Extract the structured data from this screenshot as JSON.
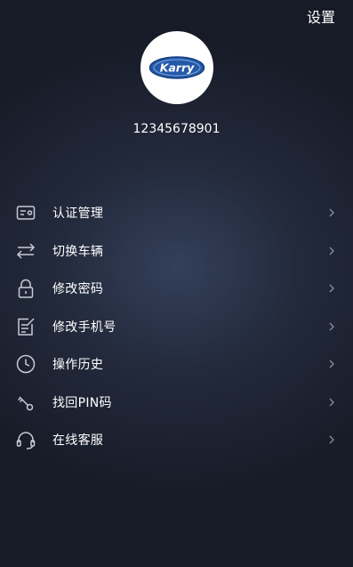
{
  "header": {
    "settings_label": "设置"
  },
  "profile": {
    "logo_text": "Karry",
    "account_number": "12345678901"
  },
  "menu": {
    "items": [
      {
        "label": "认证管理",
        "icon": "id-card-icon"
      },
      {
        "label": "切换车辆",
        "icon": "swap-arrows-icon"
      },
      {
        "label": "修改密码",
        "icon": "lock-icon"
      },
      {
        "label": "修改手机号",
        "icon": "edit-note-icon"
      },
      {
        "label": "操作历史",
        "icon": "clock-icon"
      },
      {
        "label": "找回PIN码",
        "icon": "key-icon"
      },
      {
        "label": "在线客服",
        "icon": "headset-icon"
      }
    ]
  },
  "colors": {
    "background": "#1e2433",
    "text": "#ffffff",
    "icon": "#c8ccd6",
    "chevron": "#8a90a0",
    "logo_blue": "#1d4fa0"
  }
}
